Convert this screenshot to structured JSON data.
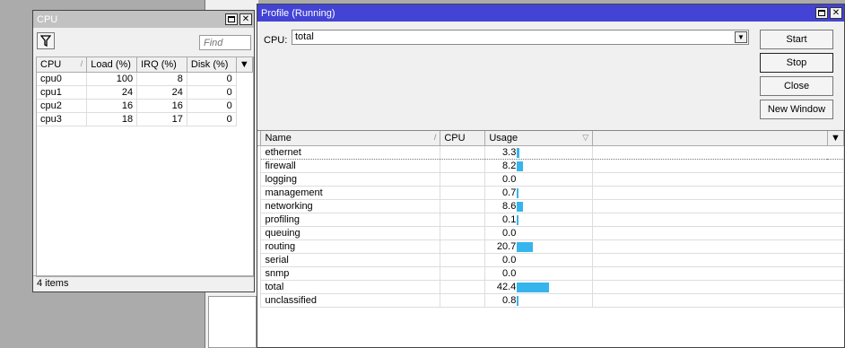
{
  "cpu_window": {
    "title": "CPU",
    "find_placeholder": "Find",
    "columns": [
      "CPU",
      "Load (%)",
      "IRQ (%)",
      "Disk (%)"
    ],
    "rows": [
      {
        "cpu": "cpu0",
        "load": "100",
        "irq": "8",
        "disk": "0"
      },
      {
        "cpu": "cpu1",
        "load": "24",
        "irq": "24",
        "disk": "0"
      },
      {
        "cpu": "cpu2",
        "load": "16",
        "irq": "16",
        "disk": "0"
      },
      {
        "cpu": "cpu3",
        "load": "18",
        "irq": "17",
        "disk": "0"
      }
    ],
    "status": "4 items"
  },
  "profile_window": {
    "title": "Profile (Running)",
    "cpu_label": "CPU:",
    "cpu_value": "total",
    "buttons": {
      "start": "Start",
      "stop": "Stop",
      "close": "Close",
      "new_window": "New Window"
    },
    "columns": [
      "Name",
      "CPU",
      "Usage"
    ],
    "rows": [
      {
        "name": "ethernet",
        "cpu": "",
        "usage": "3.3"
      },
      {
        "name": "firewall",
        "cpu": "",
        "usage": "8.2"
      },
      {
        "name": "logging",
        "cpu": "",
        "usage": "0.0"
      },
      {
        "name": "management",
        "cpu": "",
        "usage": "0.7"
      },
      {
        "name": "networking",
        "cpu": "",
        "usage": "8.6"
      },
      {
        "name": "profiling",
        "cpu": "",
        "usage": "0.1"
      },
      {
        "name": "queuing",
        "cpu": "",
        "usage": "0.0"
      },
      {
        "name": "routing",
        "cpu": "",
        "usage": "20.7"
      },
      {
        "name": "serial",
        "cpu": "",
        "usage": "0.0"
      },
      {
        "name": "snmp",
        "cpu": "",
        "usage": "0.0"
      },
      {
        "name": "total",
        "cpu": "",
        "usage": "42.4"
      },
      {
        "name": "unclassified",
        "cpu": "",
        "usage": "0.8"
      }
    ],
    "bar_color": "#36b4ec",
    "title_color": "#4343d6"
  }
}
